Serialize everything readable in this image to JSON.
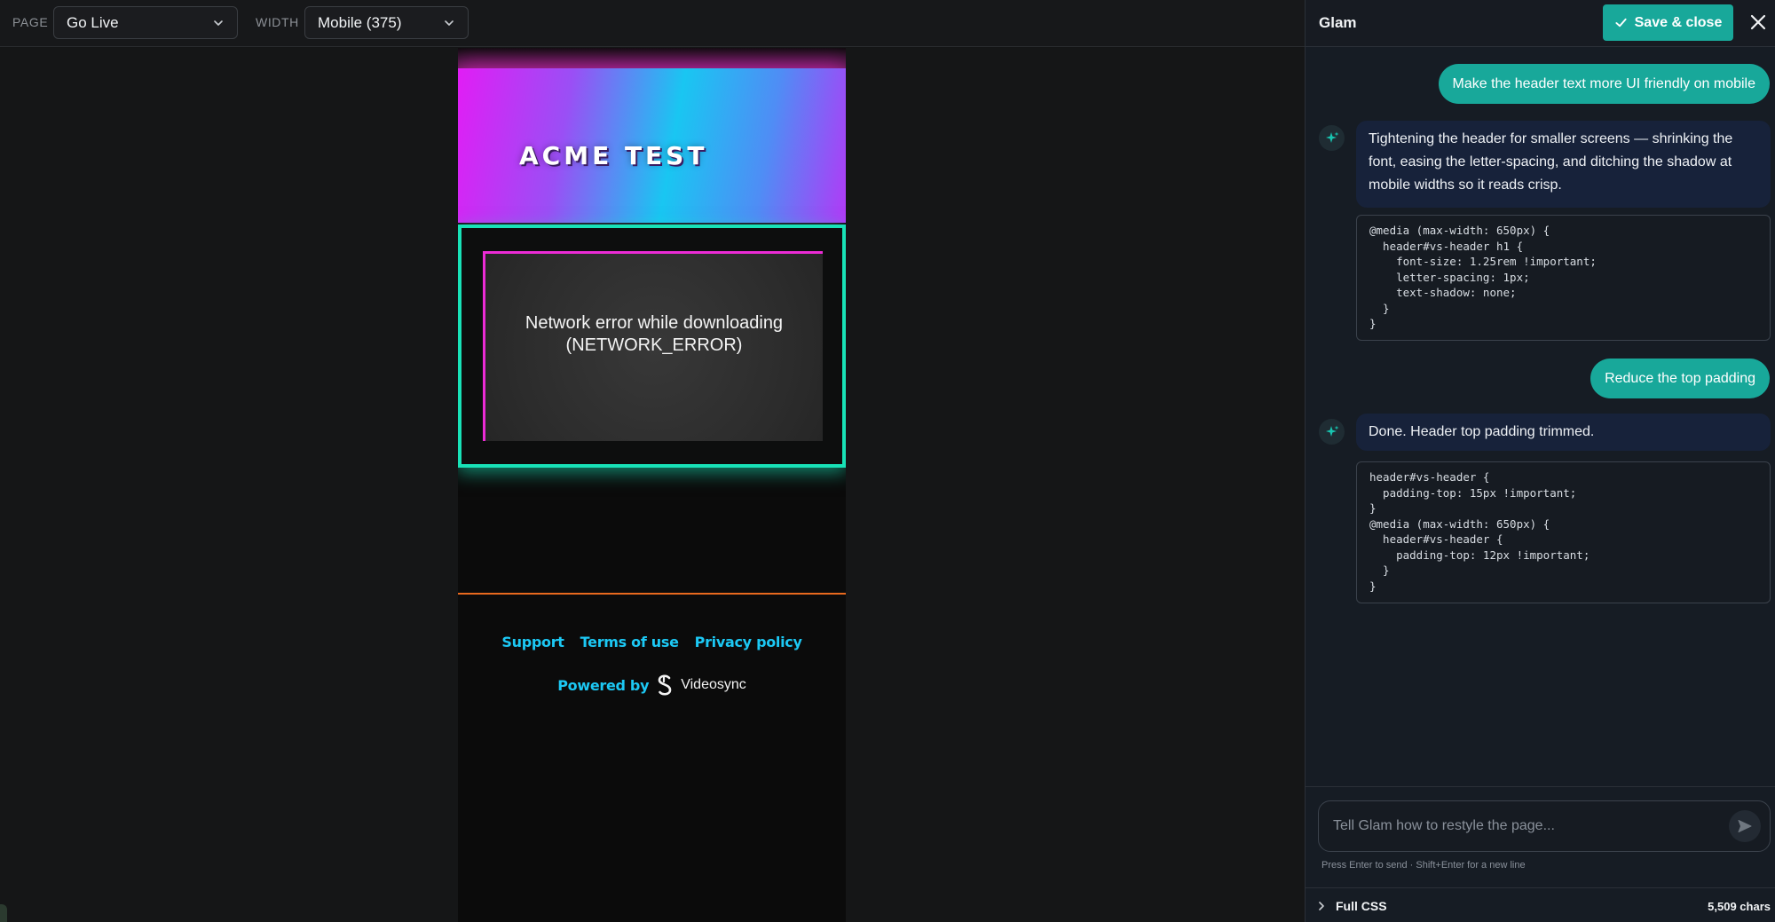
{
  "toolbar": {
    "page_label": "PAGE",
    "page_value": "Go Live",
    "width_label": "WIDTH",
    "width_value": "Mobile (375)"
  },
  "preview": {
    "header_title": "ACME TEST",
    "video_error": "Network error while downloading (NETWORK_ERROR)",
    "footer_links": [
      "Support",
      "Terms of use",
      "Privacy policy"
    ],
    "powered_by_label": "Powered by",
    "powered_by_brand": "Videosync",
    "colors": {
      "accent_cyan": "#1cc8f4",
      "frame_green": "#18e2b7",
      "divider_orange": "#e8691e",
      "magenta": "#ec2bd6"
    }
  },
  "panel": {
    "title": "Glam",
    "save_label": "Save & close",
    "close_icon": "close-icon",
    "accent": "#18a89a",
    "messages": [
      {
        "role": "user",
        "text": "Make the header text more UI friendly on mobile"
      },
      {
        "role": "assistant",
        "text": "Tightening the header for smaller screens — shrinking the font, easing the letter-spacing, and ditching the shadow at mobile widths so it reads crisp.",
        "code": [
          "@media (max-width: 650px) {",
          "  header#vs-header h1 {",
          "    font-size: 1.25rem !important;",
          "    letter-spacing: 1px;",
          "    text-shadow: none;",
          "  }",
          "}"
        ]
      },
      {
        "role": "user",
        "text": "Reduce the top padding"
      },
      {
        "role": "assistant",
        "text": "Done. Header top padding trimmed.",
        "code": [
          "header#vs-header {",
          "  padding-top: 15px !important;",
          "}",
          "@media (max-width: 650px) {",
          "  header#vs-header {",
          "    padding-top: 12px !important;",
          "  }",
          "}"
        ]
      }
    ],
    "composer": {
      "placeholder": "Tell Glam how to restyle the page...",
      "value": "",
      "hint": "Press Enter to send · Shift+Enter for a new line"
    },
    "full_css": {
      "label": "Full CSS",
      "count": "5,509 chars"
    }
  }
}
